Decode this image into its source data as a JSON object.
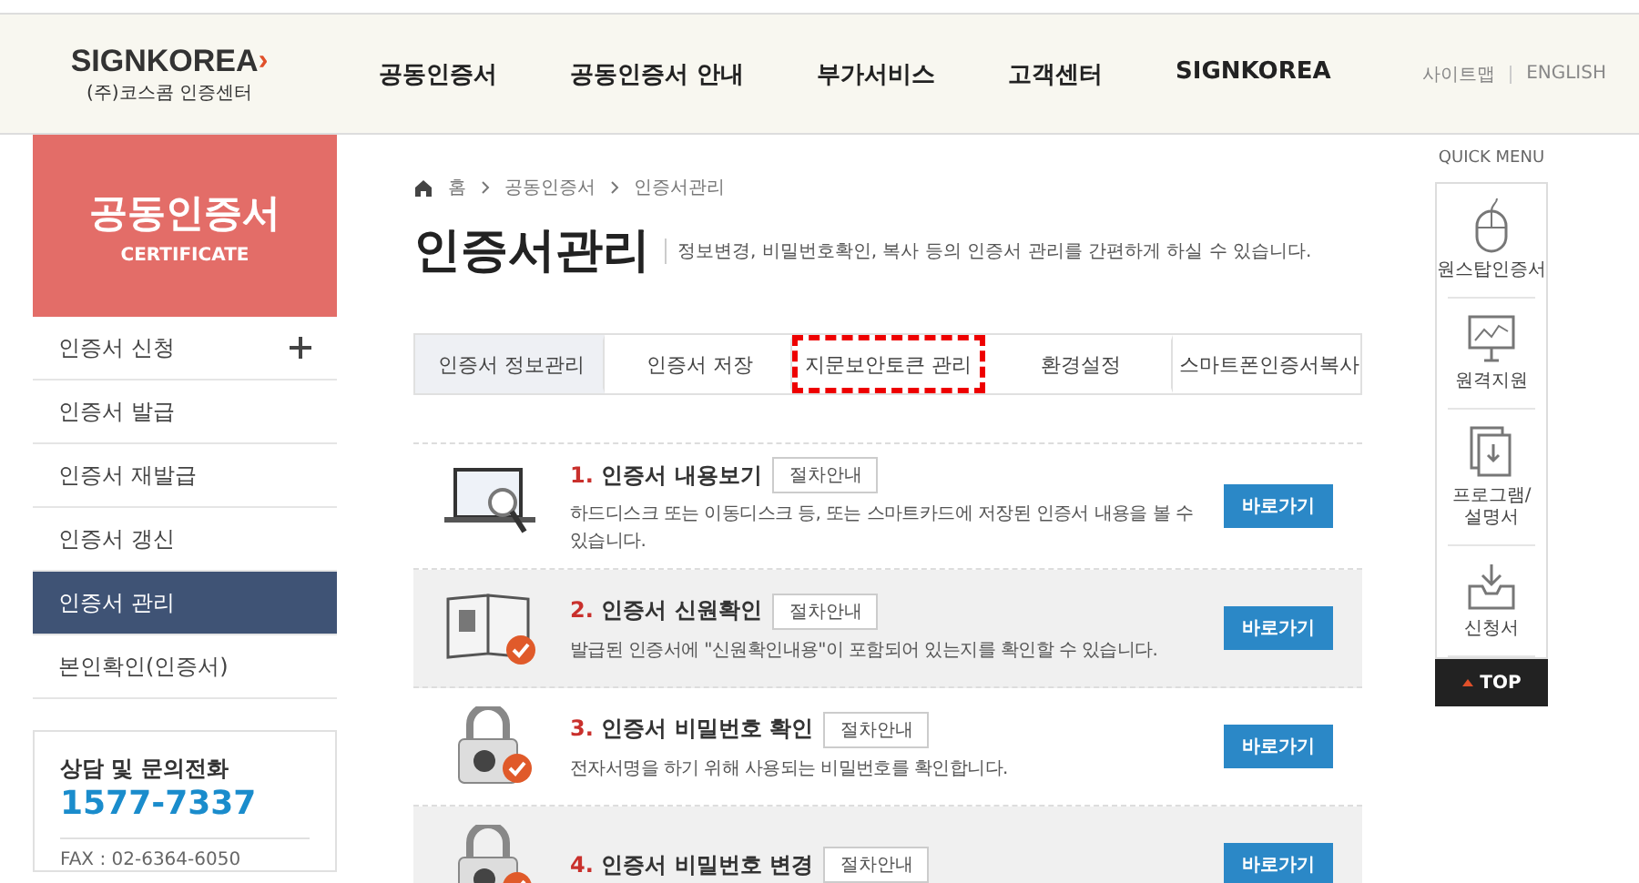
{
  "header": {
    "logo": "SIGNKOREA",
    "logo_mark": "›",
    "logo_sub": "(주)코스콤 인증센터",
    "nav": [
      "공동인증서",
      "공동인증서 안내",
      "부가서비스",
      "고객센터",
      "SIGNKOREA"
    ],
    "util_links": [
      "사이트맵",
      "ENGLISH"
    ]
  },
  "sidebar": {
    "title": "공동인증서",
    "subtitle": "CERTIFICATE",
    "items": [
      {
        "label": "인증서 신청",
        "selected": false,
        "has_submenu": true
      },
      {
        "label": "인증서 발급",
        "selected": false,
        "has_submenu": false
      },
      {
        "label": "인증서 재발급",
        "selected": false,
        "has_submenu": false
      },
      {
        "label": "인증서 갱신",
        "selected": false,
        "has_submenu": false
      },
      {
        "label": "인증서 관리",
        "selected": true,
        "has_submenu": false
      },
      {
        "label": "본인확인(인증서)",
        "selected": false,
        "has_submenu": false
      }
    ],
    "contact": {
      "title": "상담 및 문의전화",
      "phone": "1577-7337",
      "fax": "FAX : 02-6364-6050"
    }
  },
  "breadcrumb": [
    "홈",
    "공동인증서",
    "인증서관리"
  ],
  "page": {
    "title": "인증서관리",
    "description": "정보변경, 비밀번호확인, 복사 등의 인증서 관리를 간편하게 하실 수 있습니다."
  },
  "tabs": [
    {
      "label": "인증서 정보관리",
      "selected": true,
      "highlighted": false
    },
    {
      "label": "인증서 저장",
      "selected": false,
      "highlighted": false
    },
    {
      "label": "지문보안토큰 관리",
      "selected": false,
      "highlighted": true
    },
    {
      "label": "환경설정",
      "selected": false,
      "highlighted": false
    },
    {
      "label": "스마트폰인증서복사",
      "selected": false,
      "highlighted": false
    }
  ],
  "services": [
    {
      "kind": "laptop",
      "number": "1.",
      "title": "인증서 내용보기",
      "guide": "절차안내",
      "description": "하드디스크 또는 이동디스크 등, 또는 스마트카드에 저장된 인증서 내용을 볼 수 있습니다.",
      "button": "바로가기"
    },
    {
      "kind": "book",
      "number": "2.",
      "title": "인증서 신원확인",
      "guide": "절차안내",
      "description": "발급된 인증서에 \"신원확인내용\"이 포함되어 있는지를 확인할 수 있습니다.",
      "button": "바로가기"
    },
    {
      "kind": "lock",
      "number": "3.",
      "title": "인증서 비밀번호 확인",
      "guide": "절차안내",
      "description": "전자서명을 하기 위해 사용되는 비밀번호를 확인합니다.",
      "button": "바로가기"
    },
    {
      "kind": "lock",
      "number": "4.",
      "title": "인증서 비밀번호 변경",
      "guide": "절차안내",
      "button": "바로가기"
    }
  ],
  "quick_menu": {
    "title": "QUICK MENU",
    "items": [
      {
        "kind": "mouse",
        "label": "원스탑인증서"
      },
      {
        "kind": "monitor",
        "label": "원격지원"
      },
      {
        "kind": "document",
        "label": "프로그램/설명서"
      },
      {
        "kind": "inbox",
        "label": "신청서"
      }
    ],
    "top": "TOP"
  }
}
